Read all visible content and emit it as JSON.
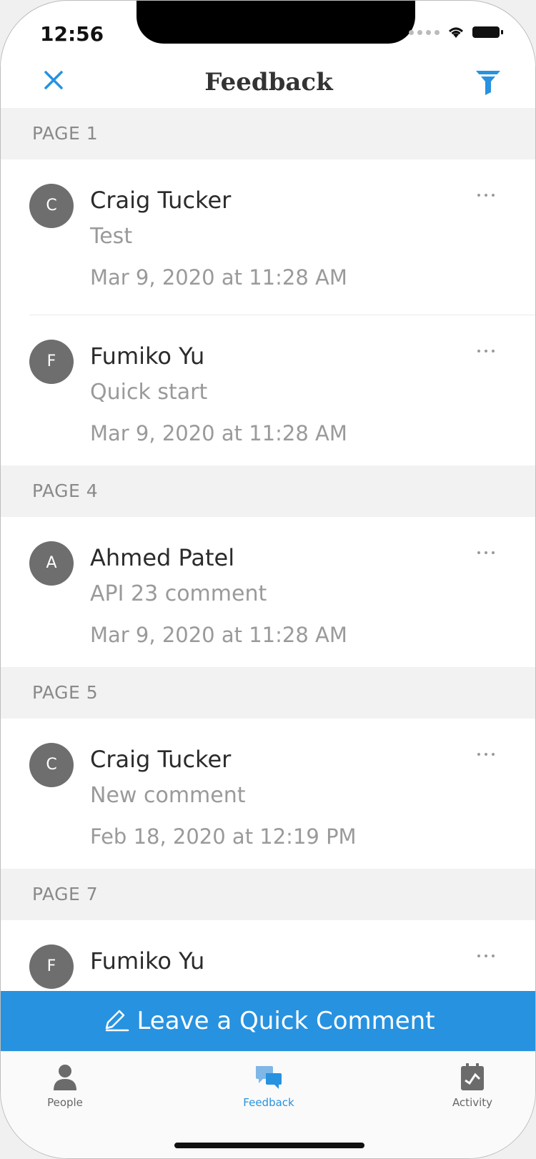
{
  "status_bar": {
    "time": "12:56"
  },
  "nav": {
    "title": "Feedback",
    "close_icon": "close-icon",
    "filter_icon": "filter-icon",
    "accent": "#2792e0"
  },
  "sections": [
    {
      "header": "PAGE 1",
      "items": [
        {
          "initial": "C",
          "name": "Craig Tucker",
          "comment": "Test",
          "date": "Mar 9, 2020 at 11:28 AM"
        },
        {
          "initial": "F",
          "name": "Fumiko Yu",
          "comment": "Quick start",
          "date": "Mar 9, 2020 at 11:28 AM"
        }
      ]
    },
    {
      "header": "PAGE 4",
      "items": [
        {
          "initial": "A",
          "name": "Ahmed Patel",
          "comment": "API 23 comment",
          "date": "Mar 9, 2020 at 11:28 AM"
        }
      ]
    },
    {
      "header": "PAGE 5",
      "items": [
        {
          "initial": "C",
          "name": "Craig Tucker",
          "comment": "New comment",
          "date": "Feb 18, 2020 at 12:19 PM"
        }
      ]
    },
    {
      "header": "PAGE 7",
      "items": [
        {
          "initial": "F",
          "name": "Fumiko Yu"
        }
      ]
    }
  ],
  "quick_comment": {
    "label": "Leave a Quick Comment",
    "icon": "pencil-icon"
  },
  "tabs": [
    {
      "label": "People",
      "icon": "person-icon"
    },
    {
      "label": "Feedback",
      "icon": "chat-bubbles-icon",
      "active": true
    },
    {
      "label": "Activity",
      "icon": "activity-icon"
    }
  ]
}
